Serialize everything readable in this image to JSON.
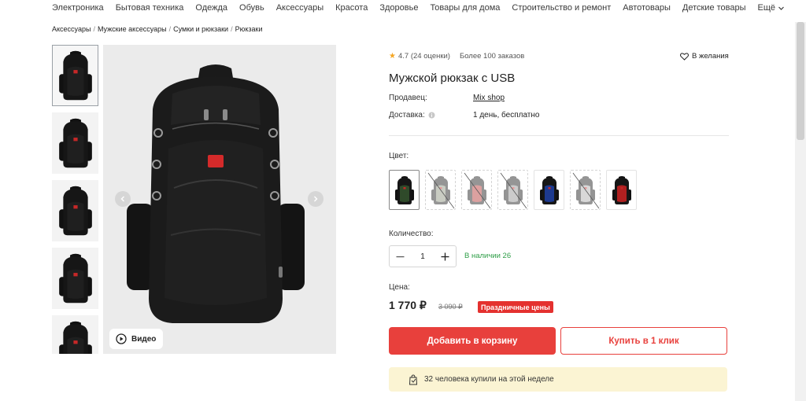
{
  "nav": {
    "categories": [
      "Электроника",
      "Бытовая техника",
      "Одежда",
      "Обувь",
      "Аксессуары",
      "Красота",
      "Здоровье",
      "Товары для дома",
      "Строительство и ремонт",
      "Автотовары",
      "Детские товары"
    ],
    "more_label": "Ещё",
    "more_icon": "chevron-down-icon"
  },
  "breadcrumbs": [
    "Аксессуары",
    "Мужские аксессуары",
    "Сумки и рюкзаки",
    "Рюкзаки"
  ],
  "breadcrumb_separator": "/",
  "gallery": {
    "thumbnails": [
      "backpack-front",
      "backpack-angle",
      "backpack-back",
      "backpack-straps",
      "backpack-usb-cable"
    ],
    "active_index": 0,
    "video_label": "Видео"
  },
  "product": {
    "rating": "4.7",
    "rating_count": "(24 оценки)",
    "orders": "Более 100 заказов",
    "wishlist_label": "В желания",
    "title": "Мужской рюкзак с USB",
    "seller_label": "Продавец:",
    "seller_value": "Mix shop",
    "delivery_label": "Доставка:",
    "delivery_value": "1 день, бесплатно"
  },
  "colors": {
    "label": "Цвет:",
    "options": [
      {
        "tone": "#2f4a2a",
        "available": true,
        "selected": true
      },
      {
        "tone": "#8a8f7a",
        "available": false,
        "selected": false
      },
      {
        "tone": "#b3312f",
        "available": false,
        "selected": false
      },
      {
        "tone": "#8e8e8e",
        "available": false,
        "selected": false
      },
      {
        "tone": "#1d3a8f",
        "available": true,
        "selected": false
      },
      {
        "tone": "#a9a9a9",
        "available": false,
        "selected": false
      },
      {
        "tone": "#b02020",
        "available": true,
        "selected": false
      }
    ]
  },
  "quantity": {
    "label": "Количество:",
    "value": "1",
    "stock": "В наличии 26"
  },
  "price": {
    "label": "Цена:",
    "current": "1 770 ₽",
    "old": "3 090 ₽",
    "badge": "Праздничные цены"
  },
  "actions": {
    "add_to_cart": "Добавить в корзину",
    "buy_one_click": "Купить в 1 клик"
  },
  "social_proof": "32 человека купили на этой неделе",
  "theme": {
    "accent": "#e8403c",
    "stock_green": "#2e9e47",
    "star": "#f5a623",
    "promo_bg": "#fbf4d3"
  }
}
